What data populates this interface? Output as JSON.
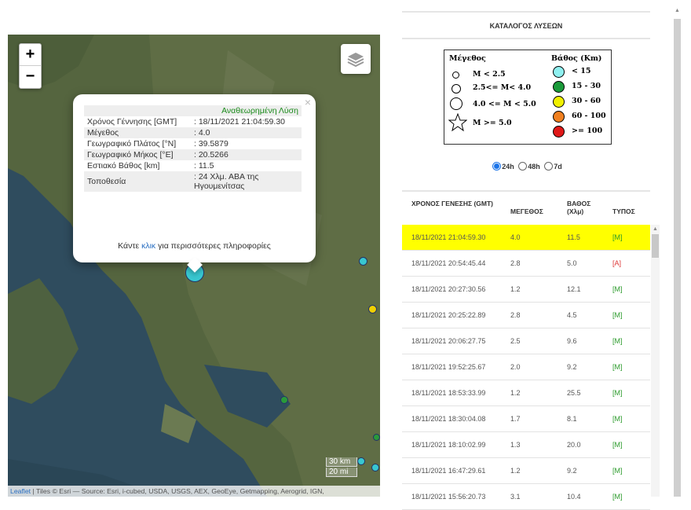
{
  "map": {
    "zoom_in": "+",
    "zoom_out": "−",
    "scale": [
      "30 km",
      "20 mi"
    ],
    "attribution_link": "Leaflet",
    "attribution_text": " | Tiles © Esri — Source: Esri, i-cubed, USDA, USGS, AEX, GeoEye, Getmapping, Aerogrid, IGN,"
  },
  "popup": {
    "title": "Αναθεωρημένη Λύση",
    "close": "×",
    "rows": [
      {
        "label": "Χρόνος Γέννησης [GMT]",
        "value": ": 18/11/2021 21:04:59.30"
      },
      {
        "label": "Μέγεθος",
        "value": ": 4.0"
      },
      {
        "label": "Γεωγραφικό Πλάτος [°N]",
        "value": ": 39.5879"
      },
      {
        "label": "Γεωγραφικό Μήκος [°E]",
        "value": ": 20.5266"
      },
      {
        "label": "Εστιακό Βάθος [km]",
        "value": ": 11.5"
      },
      {
        "label": "Τοποθεσία",
        "value": ": 24 Χλμ. ΑΒΑ της Ηγουμενίτσας"
      }
    ],
    "more_pre": "Κάντε ",
    "more_link": "κλικ",
    "more_post": " για περισσότερες πληροφορίες"
  },
  "sidebar": {
    "title": "ΚΑΤΑΛΟΓΟΣ ΛΥΣΕΩΝ",
    "legend": {
      "mag_title": "Μέγεθος",
      "mag_items": [
        "M < 2.5",
        "2.5<= M< 4.0",
        "4.0 <= M < 5.0",
        "M >= 5.0"
      ],
      "depth_title": "Βάθος (Km)",
      "depth_items": [
        "< 15",
        "15 - 30",
        "30 - 60",
        "60 - 100",
        ">= 100"
      ],
      "depth_colors": [
        "#8ff0f0",
        "#1a9a3a",
        "#f0f000",
        "#f08020",
        "#e01818"
      ]
    },
    "filter": {
      "options": [
        "24h",
        "48h",
        "7d"
      ],
      "selected": "24h"
    },
    "table": {
      "headers": [
        "ΧΡΟΝΟΣ ΓΕΝΕΣΗΣ (GMT)",
        "ΜΕΓΕΘΟΣ",
        "ΒΑΘΟΣ (Χλμ)",
        "ΤΥΠΟΣ"
      ],
      "rows": [
        [
          "18/11/2021 21:04:59.30",
          "4.0",
          "11.5",
          "[M]"
        ],
        [
          "18/11/2021 20:54:45.44",
          "2.8",
          "5.0",
          "[A]"
        ],
        [
          "18/11/2021 20:27:30.56",
          "1.2",
          "12.1",
          "[M]"
        ],
        [
          "18/11/2021 20:25:22.89",
          "2.8",
          "4.5",
          "[M]"
        ],
        [
          "18/11/2021 20:06:27.75",
          "2.5",
          "9.6",
          "[M]"
        ],
        [
          "18/11/2021 19:52:25.67",
          "2.0",
          "9.2",
          "[M]"
        ],
        [
          "18/11/2021 18:53:33.99",
          "1.2",
          "25.5",
          "[M]"
        ],
        [
          "18/11/2021 18:30:04.08",
          "1.7",
          "8.1",
          "[M]"
        ],
        [
          "18/11/2021 18:10:02.99",
          "1.3",
          "20.0",
          "[M]"
        ],
        [
          "18/11/2021 16:47:29.61",
          "1.2",
          "9.2",
          "[M]"
        ],
        [
          "18/11/2021 15:56:20.73",
          "3.1",
          "10.4",
          "[M]"
        ]
      ]
    }
  }
}
